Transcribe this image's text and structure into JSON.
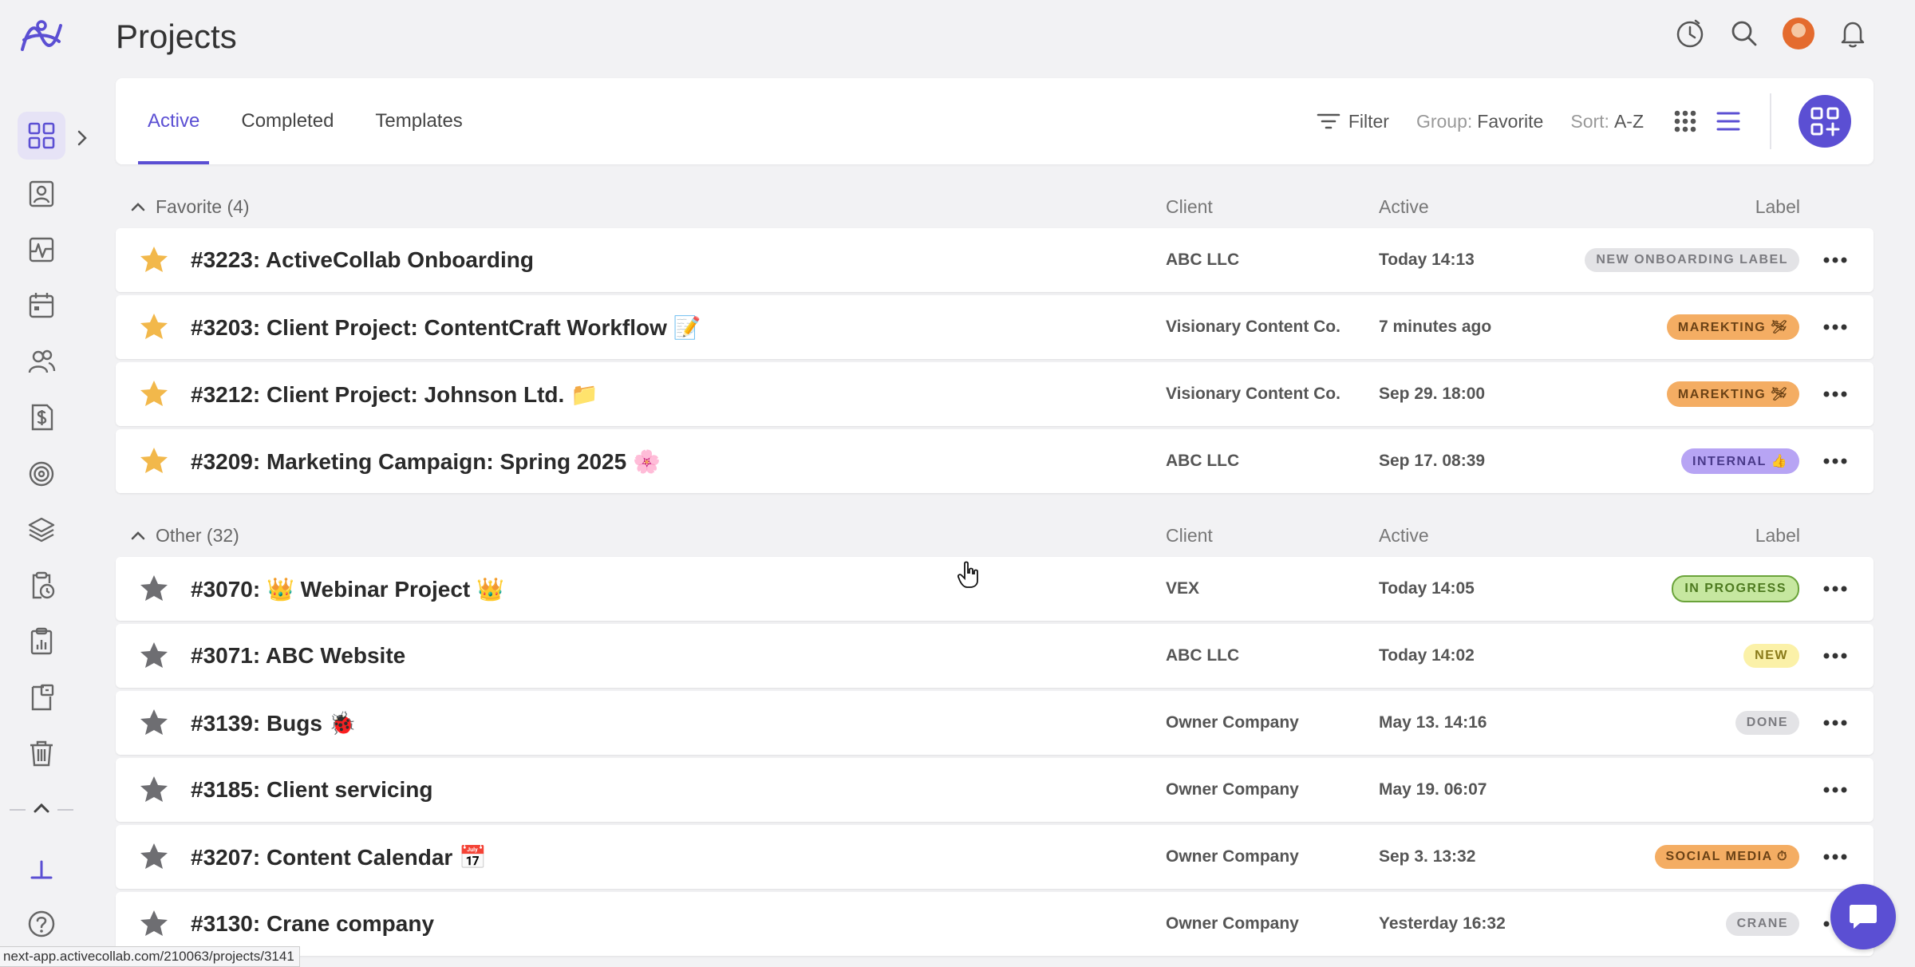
{
  "page": {
    "title": "Projects"
  },
  "sidebar": {
    "items": [
      {
        "name": "sidebar-item-projects",
        "icon": "grid-icon",
        "active": true
      },
      {
        "name": "sidebar-item-people",
        "icon": "contact-card-icon"
      },
      {
        "name": "sidebar-item-activity",
        "icon": "activity-icon"
      },
      {
        "name": "sidebar-item-calendar",
        "icon": "calendar-icon"
      },
      {
        "name": "sidebar-item-team",
        "icon": "users-icon"
      },
      {
        "name": "sidebar-item-invoices",
        "icon": "invoice-dollar-icon"
      },
      {
        "name": "sidebar-item-goals",
        "icon": "target-icon"
      },
      {
        "name": "sidebar-item-layers",
        "icon": "layers-icon"
      },
      {
        "name": "sidebar-item-timesheet",
        "icon": "clipboard-clock-icon"
      },
      {
        "name": "sidebar-item-reports",
        "icon": "clipboard-chart-icon"
      },
      {
        "name": "sidebar-item-notes",
        "icon": "document-icon"
      },
      {
        "name": "sidebar-item-trash",
        "icon": "trash-icon"
      }
    ]
  },
  "tabs": [
    {
      "label": "Active",
      "active": true
    },
    {
      "label": "Completed"
    },
    {
      "label": "Templates"
    }
  ],
  "toolbar": {
    "filter_label": "Filter",
    "group_prefix": "Group:",
    "group_value": "Favorite",
    "sort_prefix": "Sort:",
    "sort_value": "A-Z"
  },
  "columns": {
    "client": "Client",
    "active": "Active",
    "label": "Label"
  },
  "groups": [
    {
      "title": "Favorite (4)",
      "projects": [
        {
          "name": "#3223: ActiveCollab Onboarding",
          "starred": true,
          "client": "ABC LLC",
          "active": "Today 14:13",
          "label": "NEW ONBOARDING LABEL",
          "label_bg": "#e3e3e6",
          "label_fg": "#7b7b80"
        },
        {
          "name": "#3203: Client Project: ContentCraft Workflow 📝",
          "starred": true,
          "client": "Visionary Content Co.",
          "active": "7 minutes ago",
          "label": "MAREKTING 🛩",
          "label_bg": "#f4ad63",
          "label_fg": "#6b4216"
        },
        {
          "name": "#3212: Client Project: Johnson Ltd. 📁",
          "starred": true,
          "client": "Visionary Content Co.",
          "active": "Sep 29. 18:00",
          "label": "MAREKTING 🛩",
          "label_bg": "#f4ad63",
          "label_fg": "#6b4216"
        },
        {
          "name": "#3209: Marketing Campaign: Spring 2025 🌸",
          "starred": true,
          "client": "ABC LLC",
          "active": "Sep 17. 08:39",
          "label": "INTERNAL 👍",
          "label_bg": "#b7a4f4",
          "label_fg": "#4a3a8a"
        }
      ]
    },
    {
      "title": "Other (32)",
      "projects": [
        {
          "name": "#3070: 👑 Webinar Project 👑",
          "starred": false,
          "client": "VEX",
          "active": "Today 14:05",
          "label": "IN PROGRESS",
          "label_bg": "#c6e7a0",
          "label_fg": "#4d7a1f",
          "label_border": "#6aa33a"
        },
        {
          "name": "#3071: ABC Website",
          "starred": false,
          "client": "ABC LLC",
          "active": "Today 14:02",
          "label": "NEW",
          "label_bg": "#fbf1a8",
          "label_fg": "#8a7a1a"
        },
        {
          "name": "#3139: Bugs 🐞",
          "starred": false,
          "client": "Owner Company",
          "active": "May 13. 14:16",
          "label": "DONE",
          "label_bg": "#e3e3e6",
          "label_fg": "#7b7b80"
        },
        {
          "name": "#3185: Client servicing",
          "starred": false,
          "client": "Owner Company",
          "active": "May 19. 06:07",
          "label": ""
        },
        {
          "name": "#3207: Content Calendar 📅",
          "starred": false,
          "client": "Owner Company",
          "active": "Sep 3. 13:32",
          "label": "SOCIAL MEDIA ⏱",
          "label_bg": "#f4ad63",
          "label_fg": "#6b4216"
        },
        {
          "name": "#3130: Crane company",
          "starred": false,
          "client": "Owner Company",
          "active": "Yesterday 16:32",
          "label": "CRANE",
          "label_bg": "#e3e3e6",
          "label_fg": "#7b7b80"
        }
      ]
    }
  ],
  "status_bar": {
    "url": "next-app.activecollab.com/210063/projects/3141"
  },
  "colors": {
    "accent": "#5b4fd3",
    "star_favorite": "#f2b84b",
    "star_other": "#6e6e72"
  }
}
